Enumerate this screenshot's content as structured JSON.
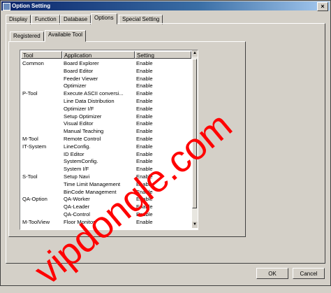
{
  "window": {
    "title": "Option Setting",
    "close_glyph": "×"
  },
  "tabs": [
    "Display",
    "Function",
    "Database",
    "Options",
    "Special Setting"
  ],
  "active_tab": "Options",
  "subtabs": [
    "Registered",
    "Available Tool"
  ],
  "active_subtab": "Available Tool",
  "columns": [
    "Tool",
    "Application",
    "Setting"
  ],
  "rows": [
    {
      "tool": "Common",
      "app": "Board Explorer",
      "setting": "Enable"
    },
    {
      "tool": "",
      "app": "Board Editor",
      "setting": "Enable"
    },
    {
      "tool": "",
      "app": "Feeder Viewer",
      "setting": "Enable"
    },
    {
      "tool": "",
      "app": "Optimizer",
      "setting": "Enable"
    },
    {
      "tool": "P-Tool",
      "app": "Execute ASCII conversi...",
      "setting": "Enable"
    },
    {
      "tool": "",
      "app": "Line Data Distribution",
      "setting": "Enable"
    },
    {
      "tool": "",
      "app": "Optimizer I/F",
      "setting": "Enable"
    },
    {
      "tool": "",
      "app": "Setup Optimizer",
      "setting": "Enable"
    },
    {
      "tool": "",
      "app": "Visual Editor",
      "setting": "Enable"
    },
    {
      "tool": "",
      "app": "Manual Teaching",
      "setting": "Enable"
    },
    {
      "tool": "M-Tool",
      "app": "Remote Control",
      "setting": "Enable"
    },
    {
      "tool": "IT-System",
      "app": "LineConfig.",
      "setting": "Enable"
    },
    {
      "tool": "",
      "app": "ID Editor",
      "setting": "Enable"
    },
    {
      "tool": "",
      "app": "SystemConfig.",
      "setting": "Enable"
    },
    {
      "tool": "",
      "app": "System I/F",
      "setting": "Enable"
    },
    {
      "tool": "S-Tool",
      "app": "Setup Navi",
      "setting": "Enable"
    },
    {
      "tool": "",
      "app": "Time Limit Management",
      "setting": "Enable"
    },
    {
      "tool": "",
      "app": "BinCode Management",
      "setting": "Enable"
    },
    {
      "tool": "QA-Option",
      "app": "QA-Worker",
      "setting": "Enable"
    },
    {
      "tool": "",
      "app": "QA-Leader",
      "setting": "Enable"
    },
    {
      "tool": "",
      "app": "QA-Control",
      "setting": "Enable"
    },
    {
      "tool": "M-ToolView",
      "app": "Floor Monitor",
      "setting": "Enable"
    }
  ],
  "buttons": {
    "ok": "OK",
    "cancel": "Cancel"
  },
  "watermark": "vipdongle.com",
  "colors": {
    "titlebar": "#0a246a",
    "watermark": "#ff0000",
    "face": "#d4d0c8"
  }
}
